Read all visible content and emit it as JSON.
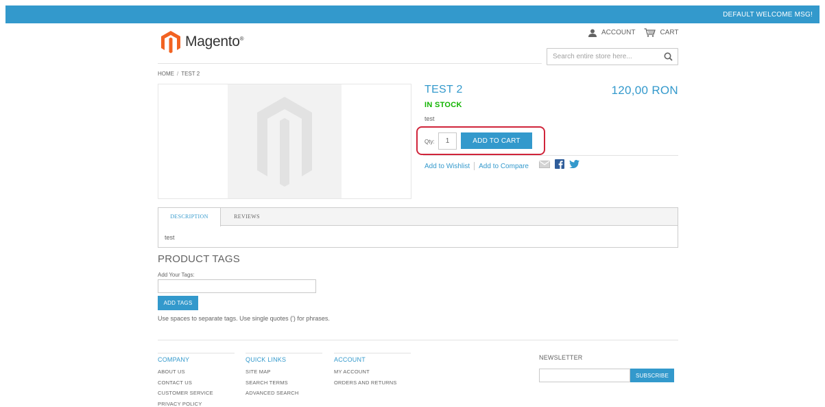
{
  "header": {
    "welcome": "DEFAULT WELCOME MSG!",
    "logo_text": "Magento",
    "logo_reg": "®",
    "account_label": "ACCOUNT",
    "cart_label": "CART",
    "search_placeholder": "Search entire store here..."
  },
  "breadcrumb": {
    "home": "HOME",
    "separator": "/",
    "current": "TEST 2"
  },
  "product": {
    "name": "TEST 2",
    "price": "120,00 RON",
    "stock": "IN STOCK",
    "short_description": "test",
    "qty_label": "Qty:",
    "qty_value": "1",
    "add_to_cart": "ADD TO CART",
    "wishlist_link": "Add to Wishlist",
    "compare_link": "Add to Compare"
  },
  "tabs": {
    "description": "DESCRIPTION",
    "reviews": "REVIEWS",
    "content": "test"
  },
  "tags": {
    "title": "PRODUCT TAGS",
    "label": "Add Your Tags:",
    "button": "ADD TAGS",
    "hint": "Use spaces to separate tags. Use single quotes (') for phrases."
  },
  "footer": {
    "columns": [
      {
        "title": "COMPANY",
        "items": [
          "ABOUT US",
          "CONTACT US",
          "CUSTOMER SERVICE",
          "PRIVACY POLICY"
        ]
      },
      {
        "title": "QUICK LINKS",
        "items": [
          "SITE MAP",
          "SEARCH TERMS",
          "ADVANCED SEARCH"
        ]
      },
      {
        "title": "ACCOUNT",
        "items": [
          "MY ACCOUNT",
          "ORDERS AND RETURNS"
        ]
      }
    ],
    "newsletter_title": "NEWSLETTER",
    "subscribe": "SUBSCRIBE"
  },
  "colors": {
    "accent": "#3399cc",
    "stock": "#11b400",
    "highlight": "#d0243a",
    "logo_orange": "#f26322"
  },
  "icons": [
    "account-icon",
    "cart-icon",
    "search-icon",
    "email-icon",
    "facebook-icon",
    "twitter-icon",
    "magento-logo-icon"
  ]
}
